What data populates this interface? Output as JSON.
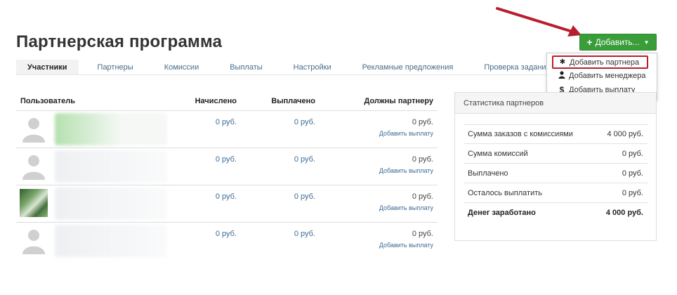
{
  "page_title": "Партнерская программа",
  "add_button": {
    "label": "Добавить..."
  },
  "tabs": [
    {
      "label": "Участники",
      "active": true
    },
    {
      "label": "Партнеры"
    },
    {
      "label": "Комиссии"
    },
    {
      "label": "Выплаты"
    },
    {
      "label": "Настройки"
    },
    {
      "label": "Рекламные предложения"
    },
    {
      "label": "Проверка заданий"
    }
  ],
  "dropdown": {
    "items": [
      {
        "label": "Добавить партнера",
        "icon": "asterisk-icon",
        "highlighted": true
      },
      {
        "label": "Добавить менеджера",
        "icon": "user-icon"
      },
      {
        "label": "Добавить выплату",
        "icon": "dollar-icon"
      }
    ]
  },
  "table": {
    "headers": {
      "user": "Пользователь",
      "accrued": "Начислено",
      "paid": "Выплачено",
      "owed": "Должны партнеру"
    },
    "rows": [
      {
        "accrued": "0 руб.",
        "paid": "0 руб.",
        "owed": "0 руб.",
        "action": "Добавить выплату"
      },
      {
        "accrued": "0 руб.",
        "paid": "0 руб.",
        "owed": "0 руб.",
        "action": "Добавить выплату"
      },
      {
        "accrued": "0 руб.",
        "paid": "0 руб.",
        "owed": "0 руб.",
        "action": "Добавить выплату"
      },
      {
        "accrued": "0 руб.",
        "paid": "0 руб.",
        "owed": "0 руб.",
        "action": "Добавить выплату"
      }
    ]
  },
  "stats": {
    "title": "Статистика партнеров",
    "rows": [
      {
        "label": "Сумма заказов с комиссиями",
        "value": "4 000 руб."
      },
      {
        "label": "Сумма комиссий",
        "value": "0 руб."
      },
      {
        "label": "Выплачено",
        "value": "0 руб."
      },
      {
        "label": "Осталось выплатить",
        "value": "0 руб."
      },
      {
        "label": "Денег заработано",
        "value": "4 000 руб."
      }
    ]
  },
  "colors": {
    "accent_green": "#3a9d3a",
    "highlight_red": "#b81e2e",
    "link_blue": "#3d6a94"
  }
}
